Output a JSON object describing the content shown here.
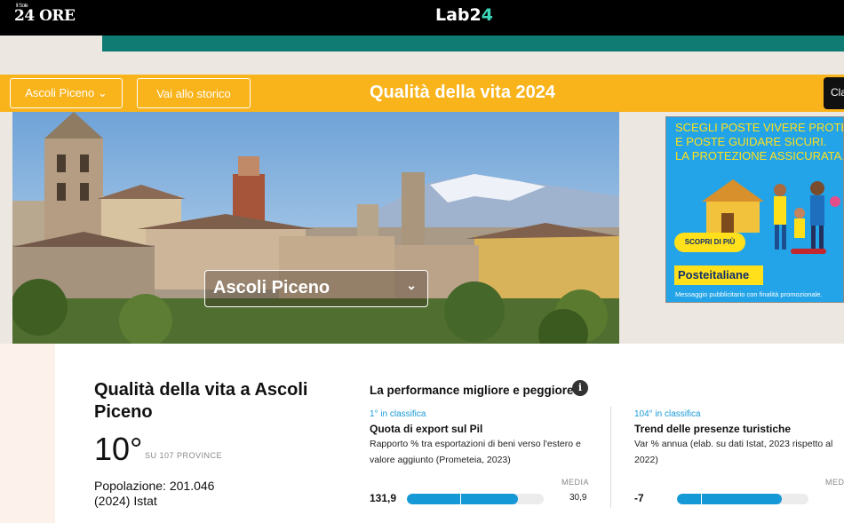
{
  "header": {
    "logo_small": "Il Sole",
    "logo_main": "24 ORE",
    "lab_logo_a": "Lab2",
    "lab_logo_b": "4"
  },
  "nav": {
    "province_button": "Ascoli Piceno ⌄",
    "history_button": "Vai allo storico",
    "title": "Qualità della vita 2024",
    "right_button": "Cla"
  },
  "hero": {
    "selected_city": "Ascoli Piceno",
    "chevron": "⌄"
  },
  "ad": {
    "headline_lines": [
      "SCEGLI POSTE VIVERE PROTET",
      "E POSTE GUIDARE SICURI.",
      "LA PROTEZIONE ASSICURATA."
    ],
    "cta": "SCOPRI DI PIÙ",
    "brand": "Posteitaliane",
    "disclaimer": "Messaggio pubblicitario con finalità promozionale.",
    "colors": {
      "background": "#23a4e8",
      "accent": "#ffe01b"
    }
  },
  "summary": {
    "title": "Qualità della vita a Ascoli Piceno",
    "rank": "10°",
    "rank_sub": "SU 107 PROVINCE",
    "population": "Popolazione: 201.046",
    "population_note": "(2024) Istat"
  },
  "performance": {
    "title": "La performance migliore e peggiore",
    "info_icon": "i",
    "best": {
      "rank_label": "1° in classifica",
      "name": "Quota di export sul Pil",
      "description": "Rapporto % tra esportazioni di beni verso l'estero e valore aggiunto (Prometeia, 2023)",
      "value": "131,9",
      "media_label": "MEDIA",
      "average": "30,9",
      "fill_fraction": 0.81,
      "avg_fraction": 0.39
    },
    "worst": {
      "rank_label": "104° in classifica",
      "name": "Trend delle presenze turistiche",
      "description": "Var % annua (elab. su dati Istat, 2023 rispetto al 2022)",
      "value": "-7",
      "media_label": "MEDIA",
      "fill_fraction": 0.8,
      "avg_fraction": 0.18
    }
  },
  "colors": {
    "nav": "#f9b31b",
    "teal": "#0f7b73",
    "bar_fill": "#1598d6",
    "rank_label": "#1a9ad8"
  }
}
